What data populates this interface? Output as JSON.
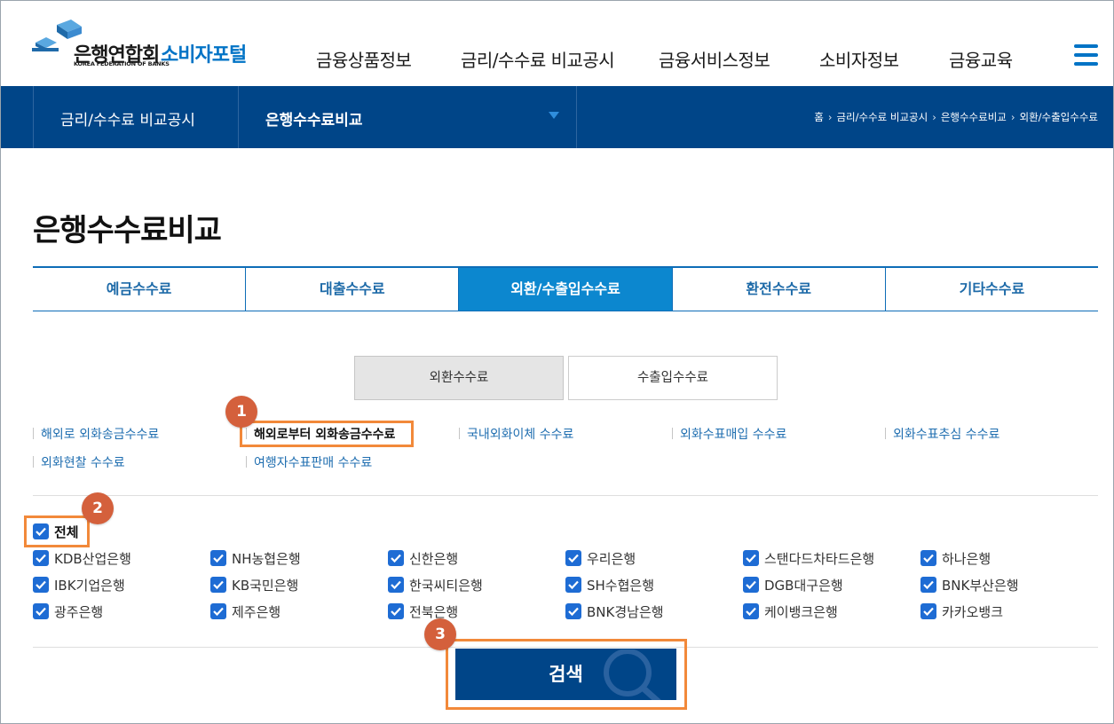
{
  "header": {
    "logo_kor": "은행연합회",
    "logo_eng": "KOREA FEDERATION OF BANKS",
    "portal": "소비자포털",
    "menu": [
      "금융상품정보",
      "금리/수수료 비교공시",
      "금융서비스정보",
      "소비자정보",
      "금융교육"
    ],
    "menu_icon": "hamburger-icon"
  },
  "subbar": {
    "section": "금리/수수료 비교공시",
    "current": "은행수수료비교",
    "breadcrumb": [
      "홈",
      "금리/수수료 비교공시",
      "은행수수료비교",
      "외환/수출입수수료"
    ]
  },
  "page_title": "은행수수료비교",
  "tabs": [
    "예금수수료",
    "대출수수료",
    "외환/수출입수수료",
    "환전수수료",
    "기타수수료"
  ],
  "active_tab": "외환/수출입수수료",
  "subtabs": [
    "외환수수료",
    "수출입수수료"
  ],
  "links": [
    "해외로 외화송금수수료",
    "해외로부터 외화송금수수료",
    "국내외화이체 수수료",
    "외화수표매입 수수료",
    "외화수표추심 수수료",
    "외화현찰 수수료",
    "여행자수표판매 수수료"
  ],
  "selected_link": "해외로부터 외화송금수수료",
  "all_label": "전체",
  "banks": [
    "KDB산업은행",
    "NH농협은행",
    "신한은행",
    "우리은행",
    "스탠다드차타드은행",
    "하나은행",
    "IBK기업은행",
    "KB국민은행",
    "한국씨티은행",
    "SH수협은행",
    "DGB대구은행",
    "BNK부산은행",
    "광주은행",
    "제주은행",
    "전북은행",
    "BNK경남은행",
    "케이뱅크은행",
    "카카오뱅크"
  ],
  "search_button": "검색",
  "markers": [
    "1",
    "2",
    "3"
  ],
  "colors": {
    "brand": "#004588",
    "accent": "#0c87cf",
    "highlight": "#f2893a",
    "marker": "#d4603c",
    "checkbox": "#1e6cd4"
  }
}
